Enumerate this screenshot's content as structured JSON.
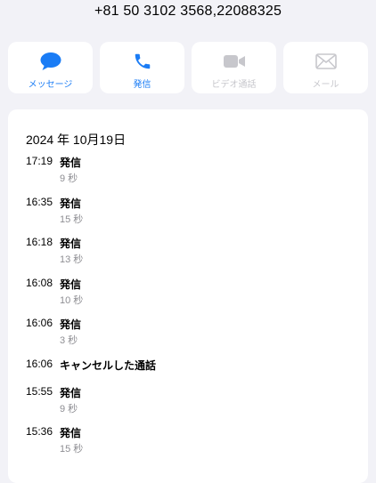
{
  "header": {
    "phone_number": "+81 50 3102 3568,22088325"
  },
  "actions": [
    {
      "label": "メッセージ",
      "icon": "message-bubble-icon",
      "enabled": true
    },
    {
      "label": "発信",
      "icon": "phone-icon",
      "enabled": true
    },
    {
      "label": "ビデオ通話",
      "icon": "video-camera-icon",
      "enabled": false
    },
    {
      "label": "メール",
      "icon": "mail-envelope-icon",
      "enabled": false
    }
  ],
  "colors": {
    "accent": "#1a7cf5",
    "disabled": "#c7c7cc",
    "secondary_text": "#8e8e93",
    "background": "#f2f2f7"
  },
  "history": {
    "date": "2024 年 10月19日",
    "calls": [
      {
        "time": "17:19",
        "type": "発信",
        "duration": "9 秒"
      },
      {
        "time": "16:35",
        "type": "発信",
        "duration": "15 秒"
      },
      {
        "time": "16:18",
        "type": "発信",
        "duration": "13 秒"
      },
      {
        "time": "16:08",
        "type": "発信",
        "duration": "10 秒"
      },
      {
        "time": "16:06",
        "type": "発信",
        "duration": "3 秒"
      },
      {
        "time": "16:06",
        "type": "キャンセルした通話",
        "duration": ""
      },
      {
        "time": "15:55",
        "type": "発信",
        "duration": "9 秒"
      },
      {
        "time": "15:36",
        "type": "発信",
        "duration": "15 秒"
      }
    ]
  }
}
